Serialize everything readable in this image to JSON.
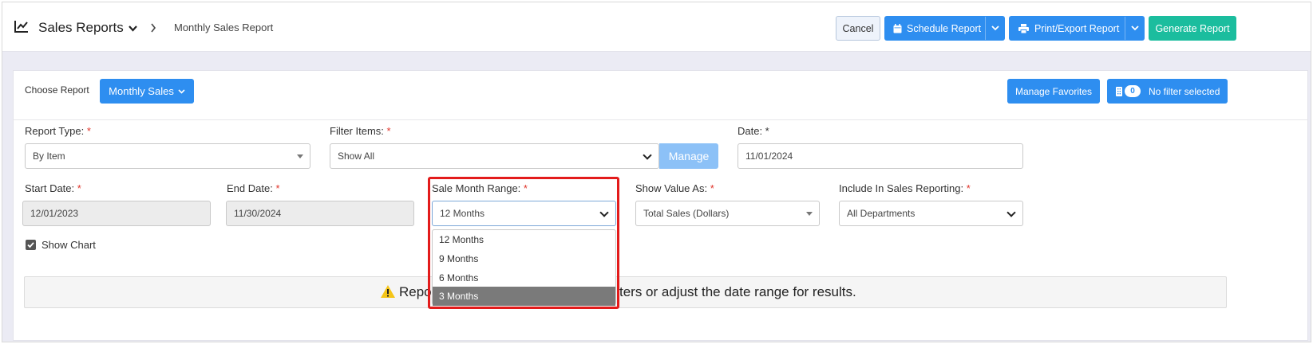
{
  "header": {
    "title": "Sales Reports",
    "breadcrumb": "Monthly Sales Report",
    "cancel_label": "Cancel",
    "schedule_label": "Schedule Report",
    "print_label": "Print/Export Report",
    "generate_label": "Generate Report"
  },
  "report_chooser": {
    "label": "Choose Report",
    "selected": "Monthly Sales",
    "manage_favorites": "Manage Favorites",
    "filter_count": "0",
    "filter_label": "No filter selected"
  },
  "form": {
    "report_type": {
      "label": "Report Type:",
      "value": "By Item"
    },
    "filter_items": {
      "label": "Filter Items:",
      "value": "Show All",
      "manage_label": "Manage"
    },
    "date": {
      "label": "Date: *",
      "value": "11/01/2024"
    },
    "start_date": {
      "label": "Start Date:",
      "value": "12/01/2023"
    },
    "end_date": {
      "label": "End Date:",
      "value": "11/30/2024"
    },
    "sale_month_range": {
      "label": "Sale Month Range:",
      "value": "12 Months",
      "options": [
        "12 Months",
        "9 Months",
        "6 Months",
        "3 Months"
      ],
      "highlighted": "3 Months"
    },
    "show_value_as": {
      "label": "Show Value As:",
      "value": "Total Sales (Dollars)"
    },
    "include_in_sales": {
      "label": "Include In Sales Reporting:",
      "value": "All Departments"
    },
    "show_chart": {
      "label": "Show Chart",
      "checked": true
    },
    "required_marker": "*"
  },
  "alert": {
    "text_left": "Repo",
    "text_right": "ters or adjust the date range for results."
  },
  "colors": {
    "primary": "#2e8ef0",
    "accent": "#1bbd9e",
    "highlight": "#e31b1b",
    "warning": "#f5c518"
  }
}
